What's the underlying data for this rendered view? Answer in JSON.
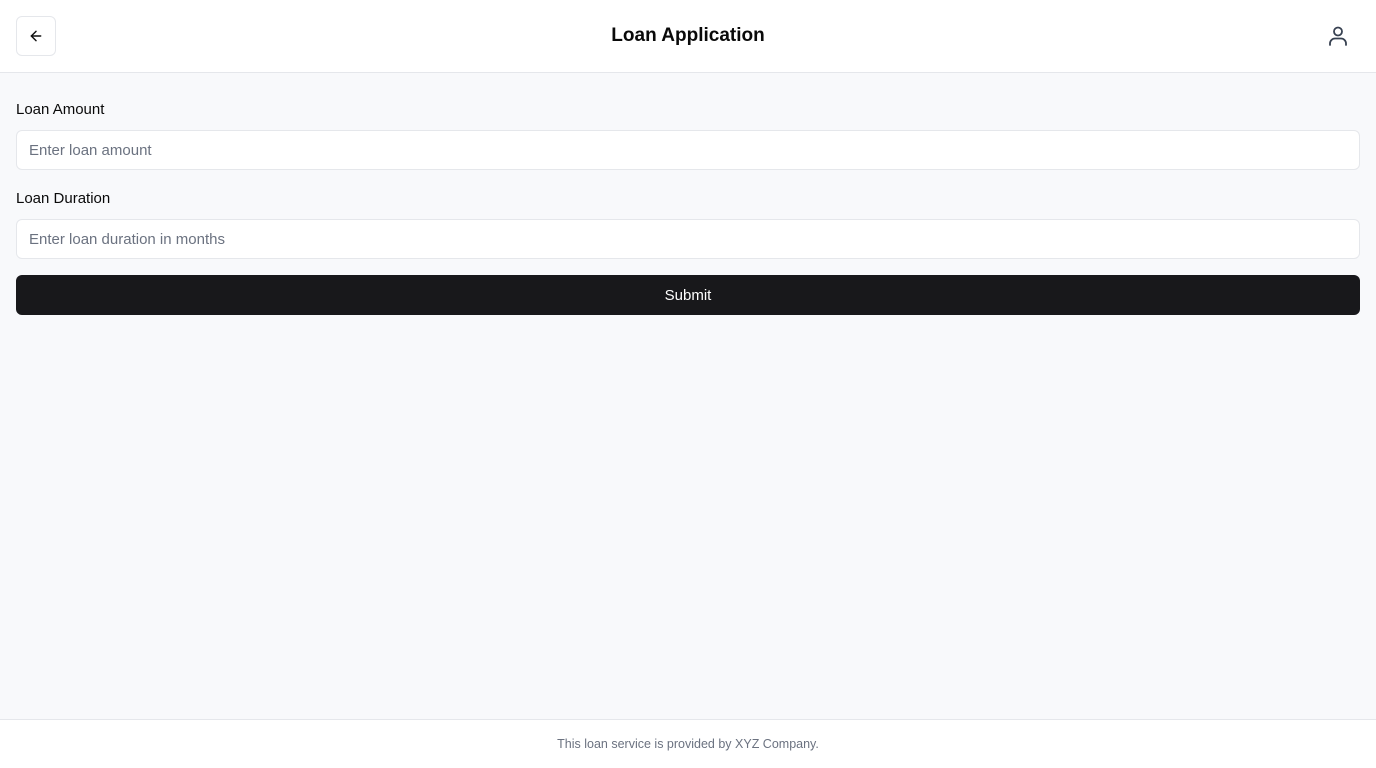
{
  "header": {
    "title": "Loan Application",
    "back_icon": "arrow-left-icon",
    "user_icon": "user-icon"
  },
  "form": {
    "amount_label": "Loan Amount",
    "amount_placeholder": "Enter loan amount",
    "amount_value": "",
    "duration_label": "Loan Duration",
    "duration_placeholder": "Enter loan duration in months",
    "duration_value": "",
    "submit_label": "Submit"
  },
  "footer": {
    "text": "This loan service is provided by XYZ Company."
  },
  "colors": {
    "background": "#f8f9fb",
    "surface": "#ffffff",
    "primary_button": "#18181b",
    "border": "#e5e7eb",
    "muted_text": "#6b7280"
  }
}
